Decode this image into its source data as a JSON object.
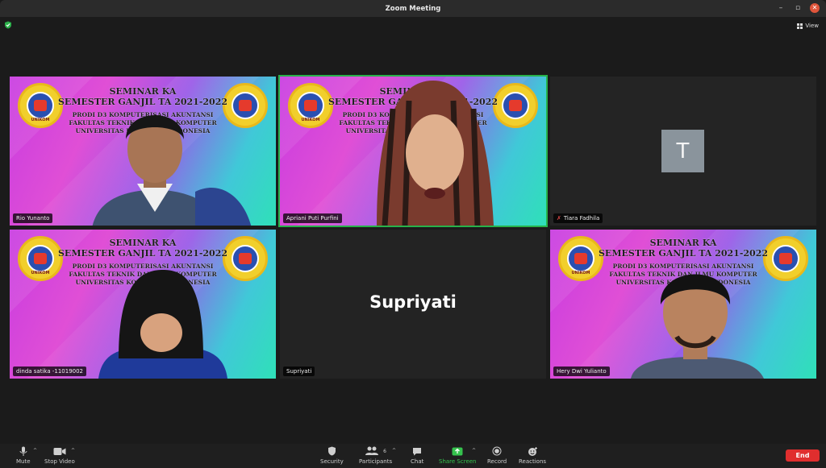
{
  "window": {
    "title": "Zoom Meeting",
    "controls": [
      "–",
      "▫",
      "✕"
    ]
  },
  "view_label": "View",
  "slide": {
    "line1": "SEMINAR KA",
    "line2": "SEMESTER GANJIL TA 2021-2022",
    "line3": "PRODI D3 KOMPUTERISASI AKUNTANSI",
    "line4": "FAKULTAS TEKNIK DAN ILMU KOMPUTER",
    "line5": "UNIVERSITAS KOMPUTER INDONESIA",
    "logo_text": "UNIKOM"
  },
  "participants": [
    {
      "name": "Rio Yunanto",
      "type": "video"
    },
    {
      "name": "Apriani Puti Purfini",
      "type": "video",
      "active_speaker": true
    },
    {
      "name": "Tiara Fadhila",
      "type": "avatar",
      "initial": "T",
      "muted": true
    },
    {
      "name": "dinda satika -11019002",
      "type": "video"
    },
    {
      "name": "Supriyati",
      "type": "name-only",
      "big_name": "Supriyati"
    },
    {
      "name": "Hery Dwi Yulianto",
      "type": "video"
    }
  ],
  "toolbar": {
    "mute": "Mute",
    "stop_video": "Stop Video",
    "security": "Security",
    "participants": "Participants",
    "participants_count": "6",
    "chat": "Chat",
    "share_screen": "Share Screen",
    "record": "Record",
    "reactions": "Reactions",
    "end": "End"
  },
  "colors": {
    "active_speaker": "#27b24a",
    "end_button": "#e02e2e",
    "share_green": "#35c24d"
  }
}
